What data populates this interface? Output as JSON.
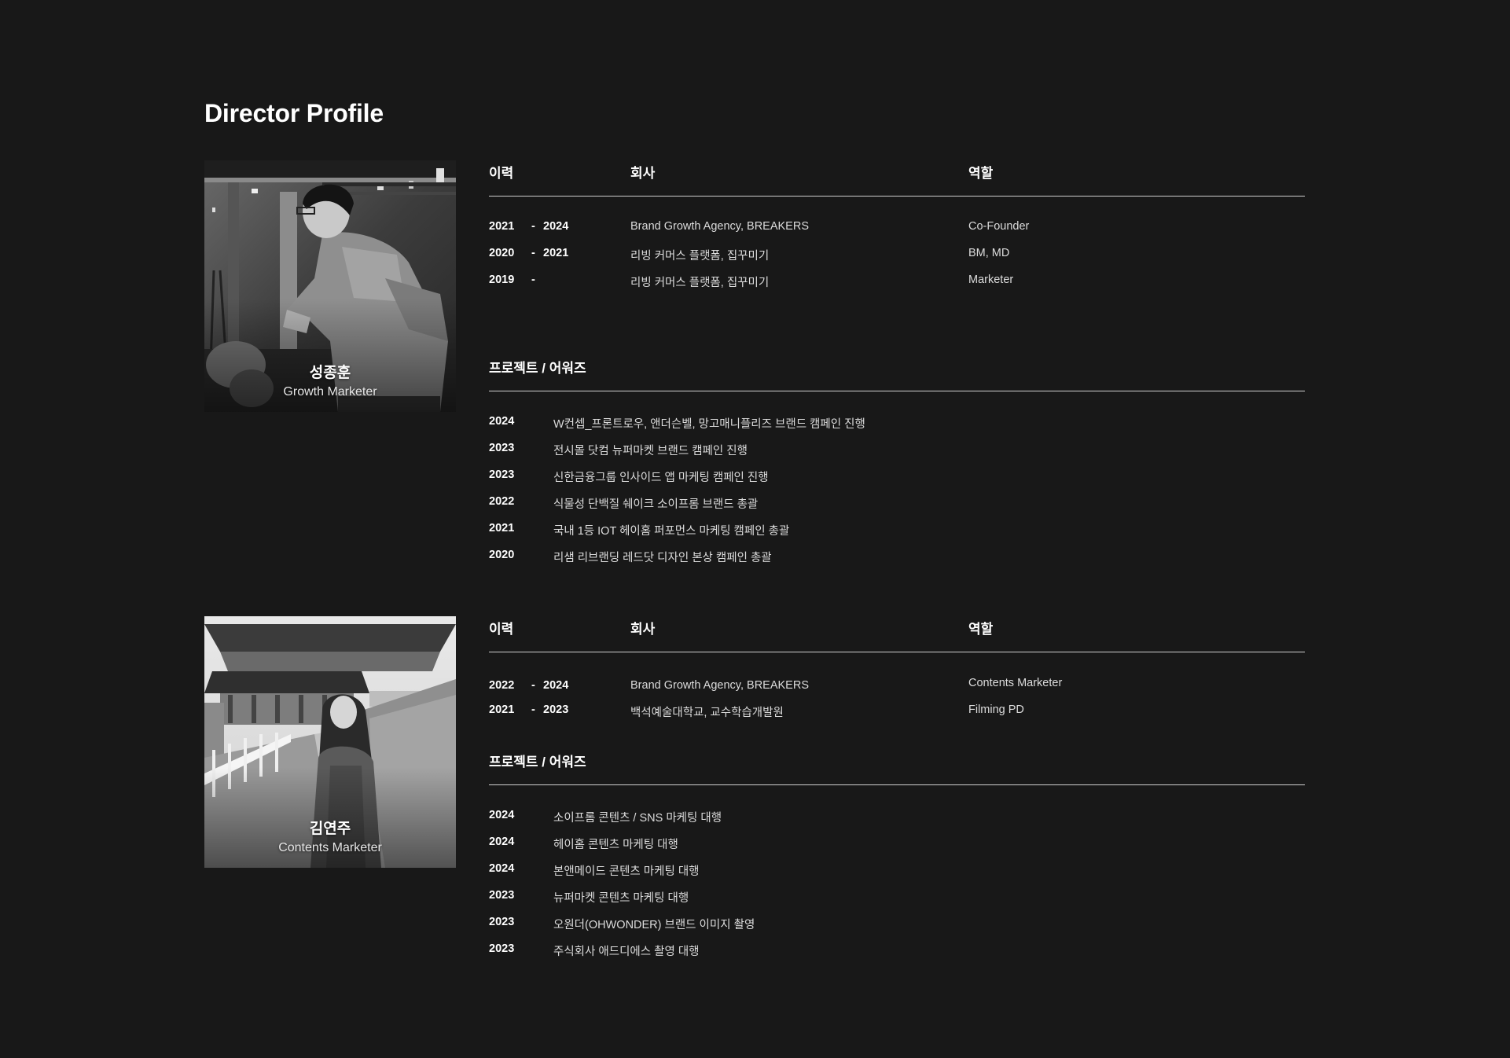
{
  "page": {
    "title": "Director Profile"
  },
  "profiles": [
    {
      "name": "성종훈",
      "role": "Growth Marketer",
      "career_headers": {
        "period": "이력",
        "company": "회사",
        "role": "역할"
      },
      "career": [
        {
          "from": "2021",
          "dash": "-",
          "to": "2024",
          "company": "Brand Growth Agency, BREAKERS",
          "role": "Co-Founder"
        },
        {
          "from": "2020",
          "dash": "-",
          "to": "2021",
          "company": "리빙 커머스 플랫폼, 집꾸미기",
          "role": "BM, MD"
        },
        {
          "from": "2019",
          "dash": "-",
          "to": "",
          "company": "리빙 커머스 플랫폼, 집꾸미기",
          "role": "Marketer"
        }
      ],
      "projects_header": "프로젝트 / 어워즈",
      "projects": [
        {
          "year": "2024",
          "title": "W컨셉_프론트로우, 앤더슨벨, 망고매니플리즈 브랜드 캠페인 진행"
        },
        {
          "year": "2023",
          "title": "전시몰 닷컴 뉴퍼마켓 브랜드 캠페인 진행"
        },
        {
          "year": "2023",
          "title": "신한금융그룹 인사이드 앱 마케팅 캠페인 진행"
        },
        {
          "year": "2022",
          "title": "식물성 단백질 쉐이크 소이프롬 브랜드 총괄"
        },
        {
          "year": "2021",
          "title": "국내 1등 IOT 헤이홈 퍼포먼스 마케팅 캠페인 총괄"
        },
        {
          "year": "2020",
          "title": "리샘 리브랜딩 레드닷 디자인 본상 캠페인 총괄"
        }
      ]
    },
    {
      "name": "김연주",
      "role": "Contents Marketer",
      "career_headers": {
        "period": "이력",
        "company": "회사",
        "role": "역할"
      },
      "career": [
        {
          "from": "2022",
          "dash": "-",
          "to": "2024",
          "company": "Brand Growth Agency, BREAKERS",
          "role": "Contents Marketer"
        },
        {
          "from": "2021",
          "dash": "-",
          "to": "2023",
          "company": "백석예술대학교, 교수학습개발원",
          "role": "Filming PD"
        }
      ],
      "projects_header": "프로젝트 / 어워즈",
      "projects": [
        {
          "year": "2024",
          "title": "소이프롬 콘텐츠 / SNS 마케팅 대행"
        },
        {
          "year": "2024",
          "title": "헤이홈 콘텐츠 마케팅 대행"
        },
        {
          "year": "2024",
          "title": "본앤메이드 콘텐츠 마케팅 대행"
        },
        {
          "year": "2023",
          "title": "뉴퍼마켓 콘텐츠 마케팅 대행"
        },
        {
          "year": "2023",
          "title": "오원더(OHWONDER) 브랜드 이미지 촬영"
        },
        {
          "year": "2023",
          "title": "주식회사 애드디에스 촬영 대행"
        }
      ]
    }
  ]
}
